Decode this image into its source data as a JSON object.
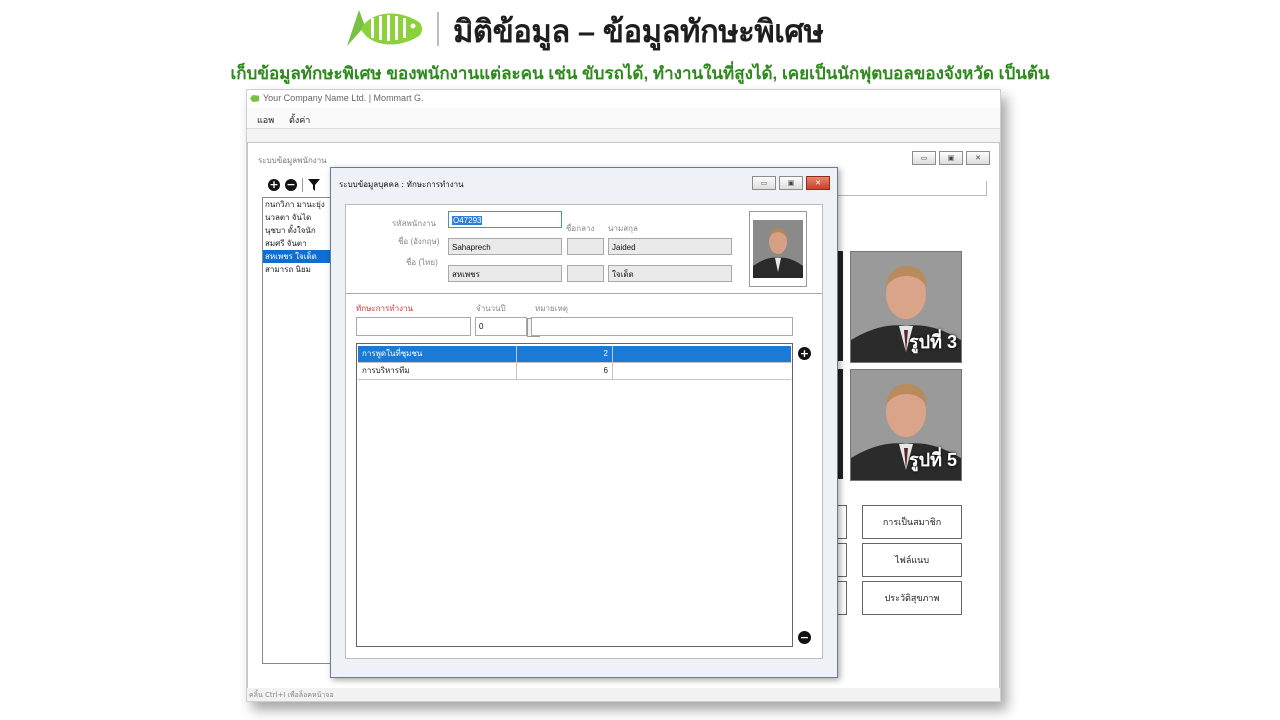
{
  "header": {
    "title": "มิติข้อมูล – ข้อมูลทักษะพิเศษ",
    "subtitle": "เก็บข้อมูลทักษะพิเศษ ของพนักงานแต่ละคน เช่น ขับรถได้, ทำงานในที่สูงได้, เคยเป็นนักฟุตบอลของจังหวัด เป็นต้น",
    "accent_color": "#7ac143"
  },
  "app": {
    "window_title": "Your Company Name Ltd. | Mommart G.",
    "menu": [
      "แอพ",
      "ตั้งค่า"
    ],
    "status": "คลิ้น Ctrl+I เพื่อล็อคหน้าจอ"
  },
  "outer_window": {
    "title": "ระบบข้อมูลพนักงาน",
    "toolbar_icons": [
      "add-icon",
      "remove-icon",
      "filter-icon"
    ],
    "employees": [
      {
        "name": "กนกวิภา มานะยุ่ง",
        "selected": false
      },
      {
        "name": "นวลตา จันได",
        "selected": false
      },
      {
        "name": "นุชบา ตั้งใจนัก",
        "selected": false
      },
      {
        "name": "สมศรี จันตา",
        "selected": false
      },
      {
        "name": "สหเพชร ใจเด็ด",
        "selected": true
      },
      {
        "name": "สามารถ นิยม",
        "selected": false
      }
    ],
    "photo_labels": [
      "รูปที่ 3",
      "รูปที่ 5"
    ],
    "side_buttons": [
      "การเป็นสมาชิก",
      "ไฟล์แนบ",
      "ประวัติสุขภาพ"
    ]
  },
  "dialog": {
    "title": "ระบบข้อมูลบุคคล : ทักษะการทำงาน",
    "labels": {
      "emp_code": "รหัสพนักงาน",
      "name_en": "ชื่อ (อังกฤษ)",
      "name_th": "ชื่อ (ไทย)",
      "middle_name": "ชื่อกลาง",
      "surname": "นามสกุล",
      "skill": "ทักษะการทำงาน",
      "years": "จำนวนปี",
      "note": "หมายเหตุ"
    },
    "values": {
      "emp_code": "O47293",
      "first_en": "Sahaprech",
      "middle_en": "",
      "last_en": "Jaided",
      "first_th": "สหเพชร",
      "middle_th": "",
      "last_th": "ใจเด็ด",
      "skill": "",
      "years": "0",
      "note": ""
    },
    "skills": [
      {
        "skill": "การพูดในที่ชุมชน",
        "years": "2",
        "note": "",
        "selected": true
      },
      {
        "skill": "การบริหารทีม",
        "years": "6",
        "note": "",
        "selected": false
      }
    ]
  }
}
